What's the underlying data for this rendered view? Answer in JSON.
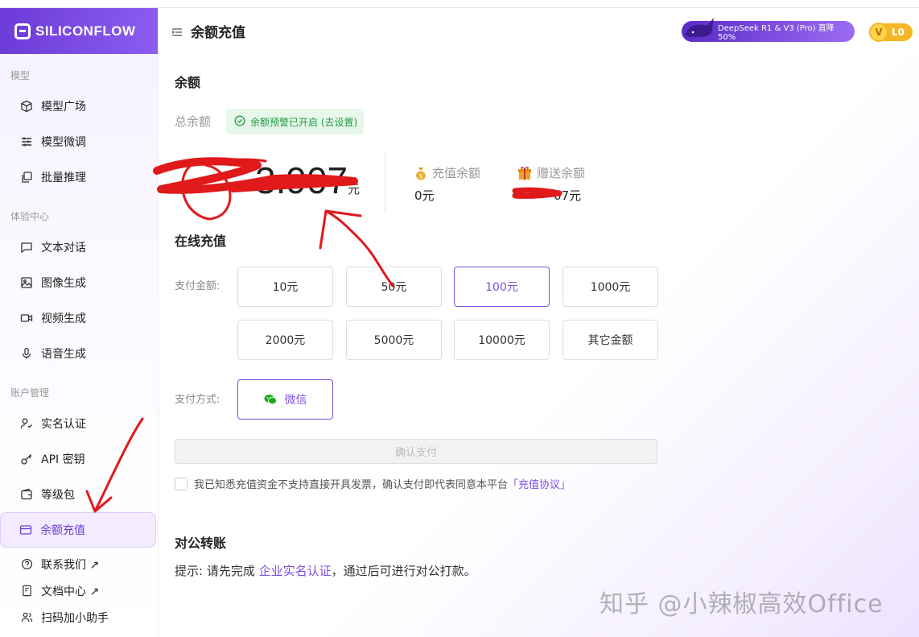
{
  "brand": {
    "logo_text": "SILICONFLOW"
  },
  "sidebar": {
    "sections": [
      {
        "label": "模型",
        "items": [
          {
            "label": "模型广场",
            "icon": "cube-icon"
          },
          {
            "label": "模型微调",
            "icon": "sliders-icon"
          },
          {
            "label": "批量推理",
            "icon": "copy-icon"
          }
        ]
      },
      {
        "label": "体验中心",
        "items": [
          {
            "label": "文本对话",
            "icon": "chat-icon"
          },
          {
            "label": "图像生成",
            "icon": "image-icon"
          },
          {
            "label": "视频生成",
            "icon": "video-icon"
          },
          {
            "label": "语音生成",
            "icon": "mic-icon"
          }
        ]
      },
      {
        "label": "账户管理",
        "items": [
          {
            "label": "实名认证",
            "icon": "user-check-icon"
          },
          {
            "label": "API 密钥",
            "icon": "key-icon"
          },
          {
            "label": "等级包",
            "icon": "wallet-icon"
          },
          {
            "label": "余额充值",
            "icon": "card-icon",
            "active": true
          }
        ]
      }
    ],
    "footer": [
      {
        "label": "联系我们 ↗",
        "icon": "help-icon"
      },
      {
        "label": "文档中心 ↗",
        "icon": "doc-icon"
      },
      {
        "label": "扫码加小助手",
        "icon": "users-icon"
      }
    ]
  },
  "header": {
    "title": "余额充值",
    "promo": "DeepSeek R1 & V3 (Pro) 直降 50%",
    "level": "L0",
    "level_v": "V"
  },
  "balance": {
    "section_title": "余额",
    "total_label": "总余额",
    "alert_text": "余额预警已开启 (去设置)",
    "total_value": "3.907",
    "unit": "元",
    "recharge_label": "充值余额",
    "recharge_value": "0元",
    "gift_label": "赠送余额",
    "gift_value": "07元"
  },
  "online": {
    "section_title": "在线充值",
    "amount_label": "支付金额:",
    "amounts": [
      "10元",
      "50元",
      "100元",
      "1000元",
      "2000元",
      "5000元",
      "10000元",
      "其它金额"
    ],
    "selected_index": 2,
    "method_label": "支付方式:",
    "method": "微信",
    "confirm": "确认支付",
    "agree_text": "我已知悉充值资金不支持直接开具发票，确认支付即代表同意本平台",
    "agree_link": "「充值协议」"
  },
  "transfer": {
    "section_title": "对公转账",
    "tip_prefix": "提示: 请先完成 ",
    "tip_link": "企业实名认证",
    "tip_suffix": "，通过后可进行对公打款。"
  },
  "watermark": "知乎 @小辣椒高效Office",
  "colors": {
    "accent": "#7d4fe0",
    "success": "#1e9b45",
    "annotation": "#e0191b"
  }
}
